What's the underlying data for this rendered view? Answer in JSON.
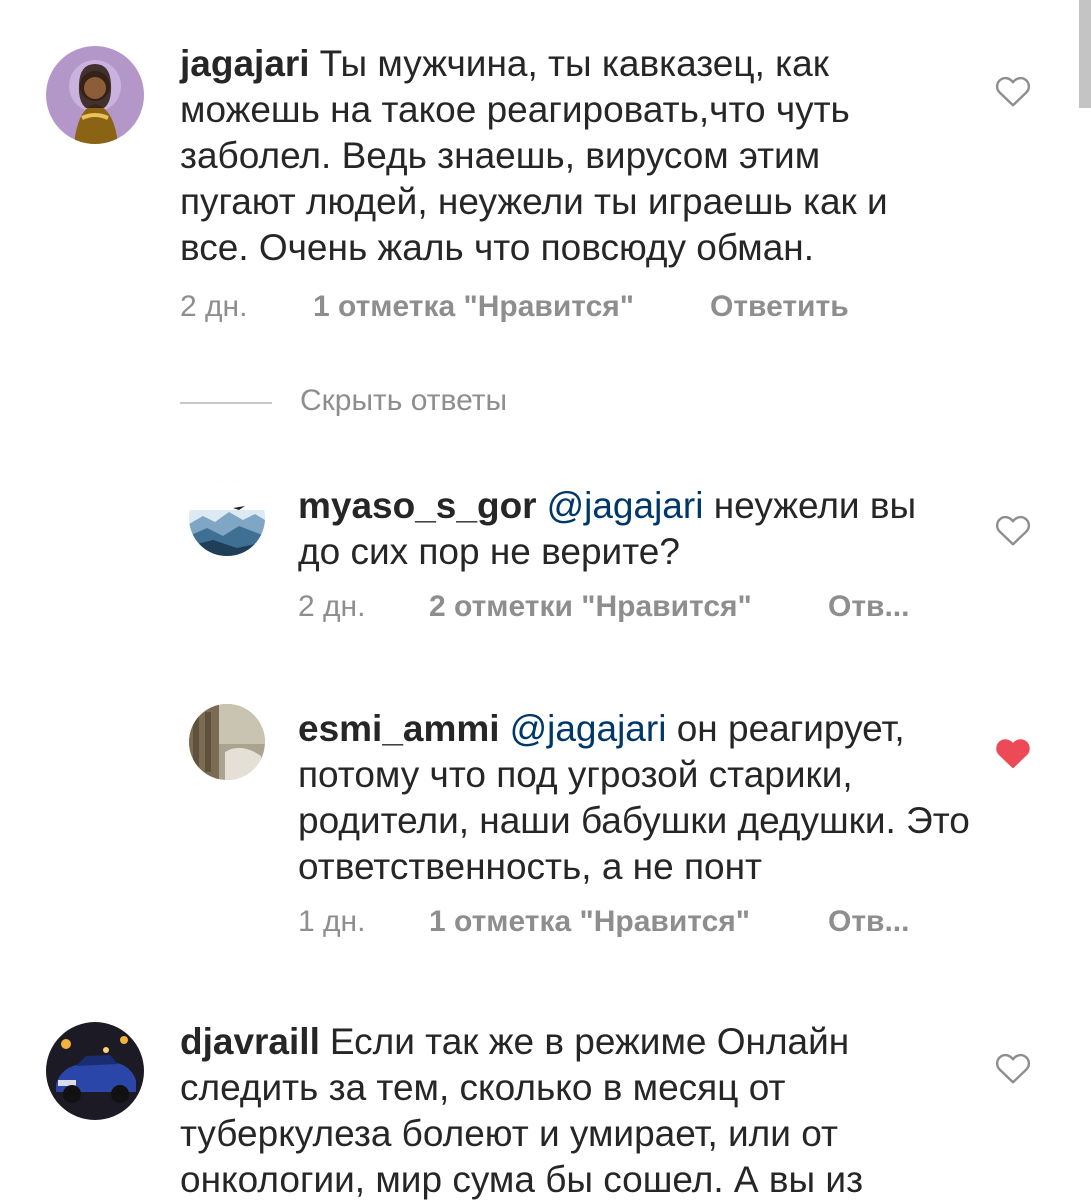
{
  "comments": [
    {
      "username": "jagajari",
      "mention": "",
      "text": "Ты мужчина, ты кавказец, как можешь на такое реагировать,что чуть заболел. Ведь знаешь, вирусом этим пугают людей, неужели ты играешь как и все. Очень жаль что повсюду обман.",
      "time": "2 дн.",
      "likes": "1 отметка \"Нравится\"",
      "reply": "Ответить",
      "liked": false
    },
    {
      "username": "myaso_s_gor",
      "mention": "@jagajari",
      "text": "неужели вы до сих пор не верите?",
      "time": "2 дн.",
      "likes": "2 отметки \"Нравится\"",
      "reply": "Отв...",
      "liked": false
    },
    {
      "username": "esmi_ammi",
      "mention": "@jagajari",
      "text": "он реагирует, потому что под угрозой старики, родители, наши бабушки дедушки. Это ответственность, а не понт",
      "time": "1 дн.",
      "likes": "1 отметка \"Нравится\"",
      "reply": "Отв...",
      "liked": true
    },
    {
      "username": "djavraill",
      "mention": "",
      "text": "Если так же в режиме Онлайн следить за тем, сколько в месяц от туберкулеза болеют и  умирает, или от онкологии, мир сума бы сошел. А вы из",
      "time": "",
      "likes": "",
      "reply": "",
      "liked": false
    }
  ],
  "hide_replies": "Скрыть ответы",
  "icons": {
    "heart_outline": "heart-outline-icon",
    "heart_filled": "heart-filled-icon"
  },
  "colors": {
    "liked_heart": "#ed4956",
    "mention": "#00376b",
    "secondary_text": "#8e8e8e"
  }
}
